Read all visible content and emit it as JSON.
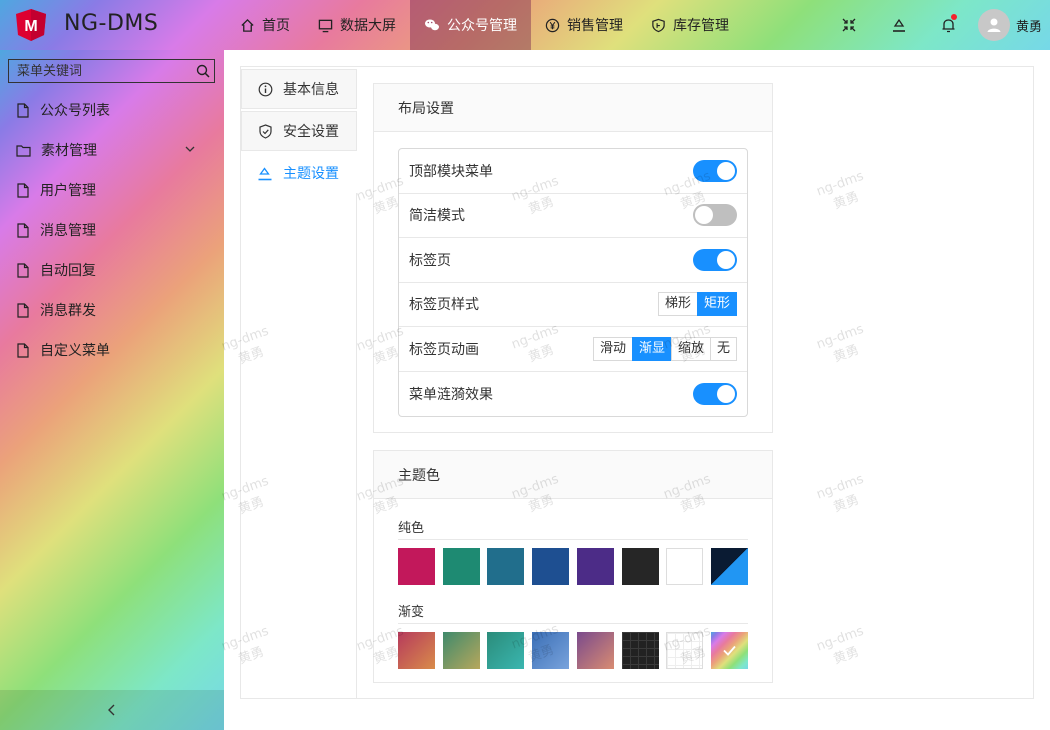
{
  "app": {
    "name": "NG-DMS"
  },
  "topnav": [
    {
      "label": "首页",
      "icon": "home-icon"
    },
    {
      "label": "数据大屏",
      "icon": "monitor-icon"
    },
    {
      "label": "公众号管理",
      "icon": "wechat-icon",
      "active": true
    },
    {
      "label": "销售管理",
      "icon": "yen-icon"
    },
    {
      "label": "库存管理",
      "icon": "shield-icon"
    }
  ],
  "user": {
    "name": "黄勇"
  },
  "sidebar": {
    "search_placeholder": "菜单关键词",
    "items": [
      {
        "label": "公众号列表"
      },
      {
        "label": "素材管理"
      },
      {
        "label": "用户管理"
      },
      {
        "label": "消息管理"
      },
      {
        "label": "自动回复"
      },
      {
        "label": "消息群发"
      },
      {
        "label": "自定义菜单"
      }
    ]
  },
  "tabs": [
    {
      "label": "基本信息"
    },
    {
      "label": "安全设置"
    },
    {
      "label": "主题设置",
      "active": true
    }
  ],
  "layout_card": {
    "title": "布局设置",
    "rows": [
      {
        "label": "顶部模块菜单",
        "switch": true
      },
      {
        "label": "简洁模式",
        "switch": false
      },
      {
        "label": "标签页",
        "switch": true
      },
      {
        "label": "标签页样式",
        "options": [
          "梯形",
          "矩形"
        ],
        "selected": "矩形"
      },
      {
        "label": "标签页动画",
        "options": [
          "滑动",
          "渐显",
          "缩放",
          "无"
        ],
        "selected": "渐显"
      },
      {
        "label": "菜单涟漪效果",
        "switch": true
      }
    ]
  },
  "theme_card": {
    "title": "主题色",
    "solid_label": "纯色",
    "gradient_label": "渐变",
    "solid_colors": [
      "#c2185b",
      "#1e8a72",
      "#216e8c",
      "#1e4f91",
      "#4c2c87",
      "#262626",
      "#ffffff",
      "#0a1b33/#2196f3"
    ],
    "gradient_colors": [
      "#b63a5c/#d98c4a",
      "#3f8a6c/#b7a75c",
      "#2b8c7a/#3ab6b0",
      "#3b6fb6/#79a3dc",
      "#7a4a8c/#d98c72",
      "#222222",
      "#ffffff",
      "rainbow"
    ]
  },
  "watermark": {
    "line1": "ng-dms",
    "line2": "黄勇"
  }
}
